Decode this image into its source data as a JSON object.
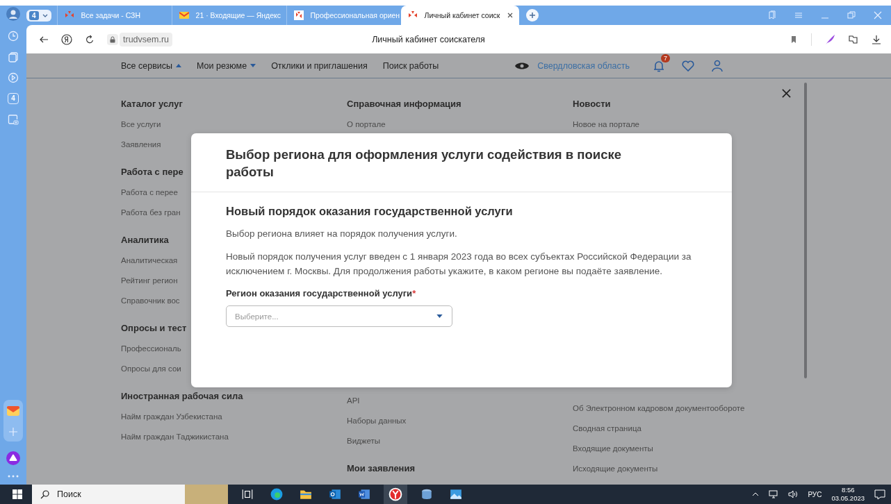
{
  "browser": {
    "tab_counter": "4",
    "tabs": [
      {
        "title": "Все задачи - СЗН",
        "kind": "site",
        "selected": false
      },
      {
        "title": "21 · Входящие — Яндекс",
        "kind": "mail",
        "selected": false
      },
      {
        "title": "Профессиональная ориен",
        "kind": "grid",
        "selected": false
      },
      {
        "title": "Личный кабинет соиск",
        "kind": "site",
        "selected": true
      }
    ],
    "url": "trudvsem.ru",
    "page_title": "Личный кабинет соискателя",
    "sidebar_badge": "4"
  },
  "site_header": {
    "nav": [
      {
        "label": "Все сервисы",
        "kind": "dropdown",
        "expanded": true
      },
      {
        "label": "Мои резюме",
        "kind": "dropdown",
        "expanded": false
      },
      {
        "label": "Отклики и приглашения",
        "kind": "link"
      },
      {
        "label": "Поиск работы",
        "kind": "link"
      }
    ],
    "region": "Свердловская область",
    "notifications": "7"
  },
  "menu": {
    "columns": [
      {
        "top": [
          {
            "kind": "heading",
            "text": "Каталог услуг"
          },
          {
            "kind": "link",
            "text": "Все услуги"
          },
          {
            "kind": "link",
            "text": "Заявления"
          },
          {
            "kind": "heading",
            "text": "Работа с пере"
          },
          {
            "kind": "link",
            "text": "Работа с перее"
          },
          {
            "kind": "link",
            "text": "Работа без гран"
          },
          {
            "kind": "heading",
            "text": "Аналитика"
          },
          {
            "kind": "link",
            "text": "Аналитическая"
          },
          {
            "kind": "link",
            "text": "Рейтинг регион"
          },
          {
            "kind": "link",
            "text": "Справочник вос"
          },
          {
            "kind": "heading",
            "text": "Опросы и тест"
          },
          {
            "kind": "link",
            "text": "Профессиональ"
          },
          {
            "kind": "link",
            "text": "Опросы для сои"
          },
          {
            "kind": "heading",
            "text": "Иностранная рабочая сила"
          },
          {
            "kind": "link",
            "text": "Найм граждан Узбекистана"
          },
          {
            "kind": "link",
            "text": "Найм граждан Таджикистана"
          }
        ]
      },
      {
        "top": [
          {
            "kind": "heading",
            "text": "Справочная информация"
          },
          {
            "kind": "link",
            "text": "О портале"
          }
        ],
        "bottom": [
          {
            "kind": "link",
            "text": "API"
          },
          {
            "kind": "link",
            "text": "Наборы данных"
          },
          {
            "kind": "link",
            "text": "Виджеты"
          },
          {
            "kind": "heading",
            "text": "Мои заявления"
          }
        ]
      },
      {
        "top": [
          {
            "kind": "heading",
            "text": "Новости"
          },
          {
            "kind": "link",
            "text": "Новое на портале"
          }
        ],
        "bottom": [
          {
            "kind": "link",
            "text": "Об Электронном кадровом документообороте"
          },
          {
            "kind": "link",
            "text": "Сводная страница"
          },
          {
            "kind": "link",
            "text": "Входящие документы"
          },
          {
            "kind": "link",
            "text": "Исходящие документы"
          }
        ]
      }
    ]
  },
  "modal": {
    "title": "Выбор региона для оформления услуги содействия в поиске работы",
    "subtitle": "Новый порядок оказания государственной услуги",
    "paragraphs": [
      "Выбор региона влияет на порядок получения услуги.",
      "Новый порядок получения услуг введен с 1 января 2023 года во всех субъектах Российской Федерации за исключением г. Москвы. Для продолжения работы укажите, в каком регионе вы подаёте заявление."
    ],
    "field": {
      "label": "Регион оказания государственной услуги",
      "required_mark": "*",
      "placeholder": "Выберите..."
    }
  },
  "taskbar": {
    "search": "Поиск",
    "language": "РУС",
    "time": "8:56",
    "date": "03.05.2023"
  }
}
